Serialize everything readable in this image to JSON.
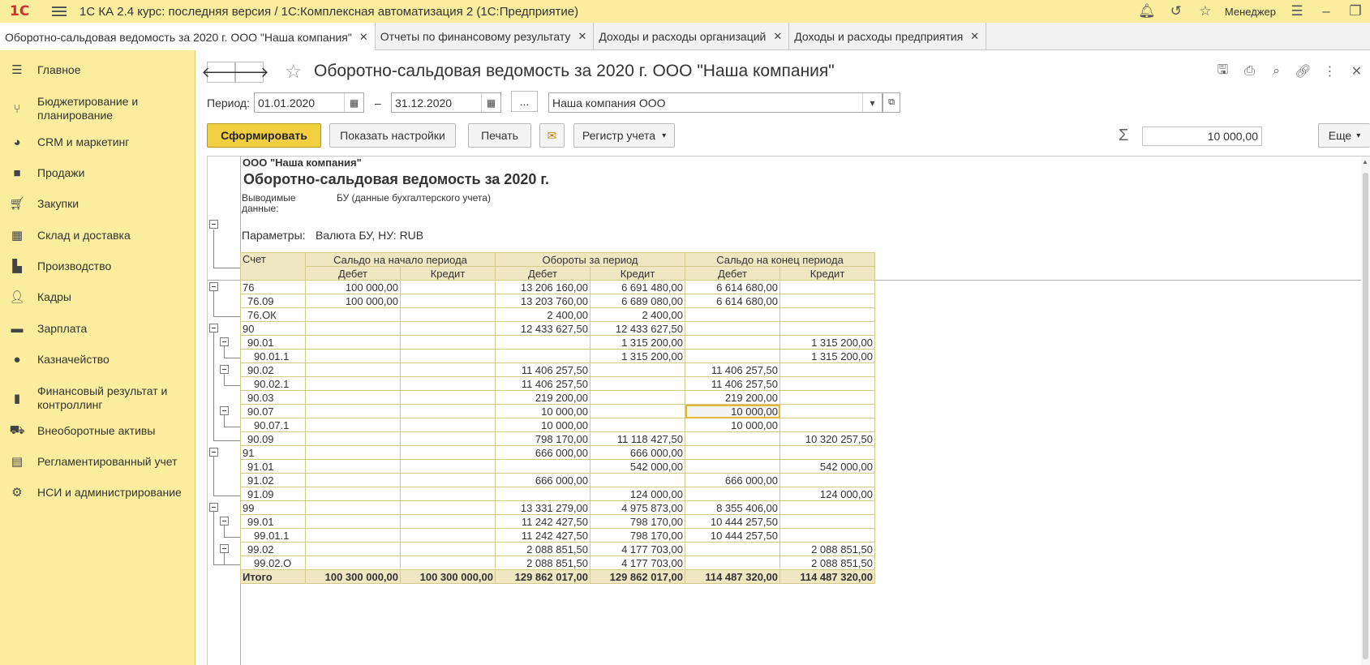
{
  "app": {
    "logo": "1С",
    "title": "1С КА 2.4 курс: последняя версия / 1С:Комплексная автоматизация 2  (1С:Предприятие)",
    "user": "Менеджер"
  },
  "tabs": [
    {
      "label": "Оборотно-сальдовая ведомость за 2020 г. ООО \"Наша компания\"",
      "close": "✕"
    },
    {
      "label": "Отчеты по финансовому результату",
      "close": "✕"
    },
    {
      "label": "Доходы и расходы организаций",
      "close": "✕"
    },
    {
      "label": "Доходы и расходы предприятия",
      "close": "✕"
    }
  ],
  "sidebar": {
    "items": [
      {
        "label": "Главное",
        "icon": "menu-icon"
      },
      {
        "label": "Бюджетирование и планирование",
        "icon": "budget-icon"
      },
      {
        "label": "CRM и маркетинг",
        "icon": "pie-chart-icon"
      },
      {
        "label": "Продажи",
        "icon": "bag-icon"
      },
      {
        "label": "Закупки",
        "icon": "cart-icon"
      },
      {
        "label": "Склад и доставка",
        "icon": "warehouse-icon"
      },
      {
        "label": "Производство",
        "icon": "factory-icon"
      },
      {
        "label": "Кадры",
        "icon": "person-icon"
      },
      {
        "label": "Зарплата",
        "icon": "wallet-icon"
      },
      {
        "label": "Казначейство",
        "icon": "coin-icon"
      },
      {
        "label": "Финансовый результат и контроллинг",
        "icon": "bar-chart-icon"
      },
      {
        "label": "Внеоборотные активы",
        "icon": "assets-icon"
      },
      {
        "label": "Регламентированный учет",
        "icon": "calculator-icon"
      },
      {
        "label": "НСИ и администрирование",
        "icon": "gear-icon"
      }
    ]
  },
  "doc": {
    "title": "Оборотно-сальдовая ведомость за 2020 г. ООО \"Наша компания\"",
    "period_label": "Период:",
    "date_from": "01.01.2020",
    "dash": "–",
    "date_to": "31.12.2020",
    "dots": "...",
    "organization": "Наша компания ООО",
    "buttons": {
      "generate": "Сформировать",
      "settings": "Показать настройки",
      "print": "Печать",
      "register": "Регистр учета",
      "more": "Еще"
    },
    "sum": "10 000,00"
  },
  "report": {
    "org": "ООО \"Наша компания\"",
    "title": "Оборотно-сальдовая ведомость за 2020 г.",
    "output_label_1": "Выводимые",
    "output_label_2": "данные:",
    "output_value": "БУ (данные бухгалтерского учета)",
    "params_label": "Параметры:",
    "params_value": "Валюта БУ, НУ: RUB",
    "header": {
      "account": "Счет",
      "opening": "Сальдо на начало периода",
      "turnover": "Обороты за период",
      "closing": "Сальдо на конец периода",
      "debit": "Дебет",
      "credit": "Кредит"
    },
    "rows": [
      {
        "acct": "76",
        "ind": 0,
        "v": [
          "100 000,00",
          "",
          "13 206 160,00",
          "6 691 480,00",
          "6 614 680,00",
          ""
        ]
      },
      {
        "acct": "76.09",
        "ind": 1,
        "v": [
          "100 000,00",
          "",
          "13 203 760,00",
          "6 689 080,00",
          "6 614 680,00",
          ""
        ]
      },
      {
        "acct": "76.ОК",
        "ind": 1,
        "v": [
          "",
          "",
          "2 400,00",
          "2 400,00",
          "",
          ""
        ]
      },
      {
        "acct": "90",
        "ind": 0,
        "v": [
          "",
          "",
          "12 433 627,50",
          "12 433 627,50",
          "",
          ""
        ]
      },
      {
        "acct": "90.01",
        "ind": 1,
        "v": [
          "",
          "",
          "",
          "1 315 200,00",
          "",
          "1 315 200,00"
        ]
      },
      {
        "acct": "90.01.1",
        "ind": 2,
        "v": [
          "",
          "",
          "",
          "1 315 200,00",
          "",
          "1 315 200,00"
        ]
      },
      {
        "acct": "90.02",
        "ind": 1,
        "v": [
          "",
          "",
          "11 406 257,50",
          "",
          "11 406 257,50",
          ""
        ]
      },
      {
        "acct": "90.02.1",
        "ind": 2,
        "v": [
          "",
          "",
          "11 406 257,50",
          "",
          "11 406 257,50",
          ""
        ]
      },
      {
        "acct": "90.03",
        "ind": 1,
        "v": [
          "",
          "",
          "219 200,00",
          "",
          "219 200,00",
          ""
        ]
      },
      {
        "acct": "90.07",
        "ind": 1,
        "v": [
          "",
          "",
          "10 000,00",
          "",
          "10 000,00",
          ""
        ]
      },
      {
        "acct": "90.07.1",
        "ind": 2,
        "v": [
          "",
          "",
          "10 000,00",
          "",
          "10 000,00",
          ""
        ]
      },
      {
        "acct": "90.09",
        "ind": 1,
        "v": [
          "",
          "",
          "798 170,00",
          "11 118 427,50",
          "",
          "10 320 257,50"
        ]
      },
      {
        "acct": "91",
        "ind": 0,
        "v": [
          "",
          "",
          "666 000,00",
          "666 000,00",
          "",
          ""
        ]
      },
      {
        "acct": "91.01",
        "ind": 1,
        "v": [
          "",
          "",
          "",
          "542 000,00",
          "",
          "542 000,00"
        ]
      },
      {
        "acct": "91.02",
        "ind": 1,
        "v": [
          "",
          "",
          "666 000,00",
          "",
          "666 000,00",
          ""
        ]
      },
      {
        "acct": "91.09",
        "ind": 1,
        "v": [
          "",
          "",
          "",
          "124 000,00",
          "",
          "124 000,00"
        ]
      },
      {
        "acct": "99",
        "ind": 0,
        "v": [
          "",
          "",
          "13 331 279,00",
          "4 975 873,00",
          "8 355 406,00",
          ""
        ]
      },
      {
        "acct": "99.01",
        "ind": 1,
        "v": [
          "",
          "",
          "11 242 427,50",
          "798 170,00",
          "10 444 257,50",
          ""
        ]
      },
      {
        "acct": "99.01.1",
        "ind": 2,
        "v": [
          "",
          "",
          "11 242 427,50",
          "798 170,00",
          "10 444 257,50",
          ""
        ]
      },
      {
        "acct": "99.02",
        "ind": 1,
        "v": [
          "",
          "",
          "2 088 851,50",
          "4 177 703,00",
          "",
          "2 088 851,50"
        ]
      },
      {
        "acct": "99.02.О",
        "ind": 2,
        "v": [
          "",
          "",
          "2 088 851,50",
          "4 177 703,00",
          "",
          "2 088 851,50"
        ]
      }
    ],
    "total": {
      "label": "Итого",
      "v": [
        "100 300 000,00",
        "100 300 000,00",
        "129 862 017,00",
        "129 862 017,00",
        "114 487 320,00",
        "114 487 320,00"
      ]
    }
  }
}
